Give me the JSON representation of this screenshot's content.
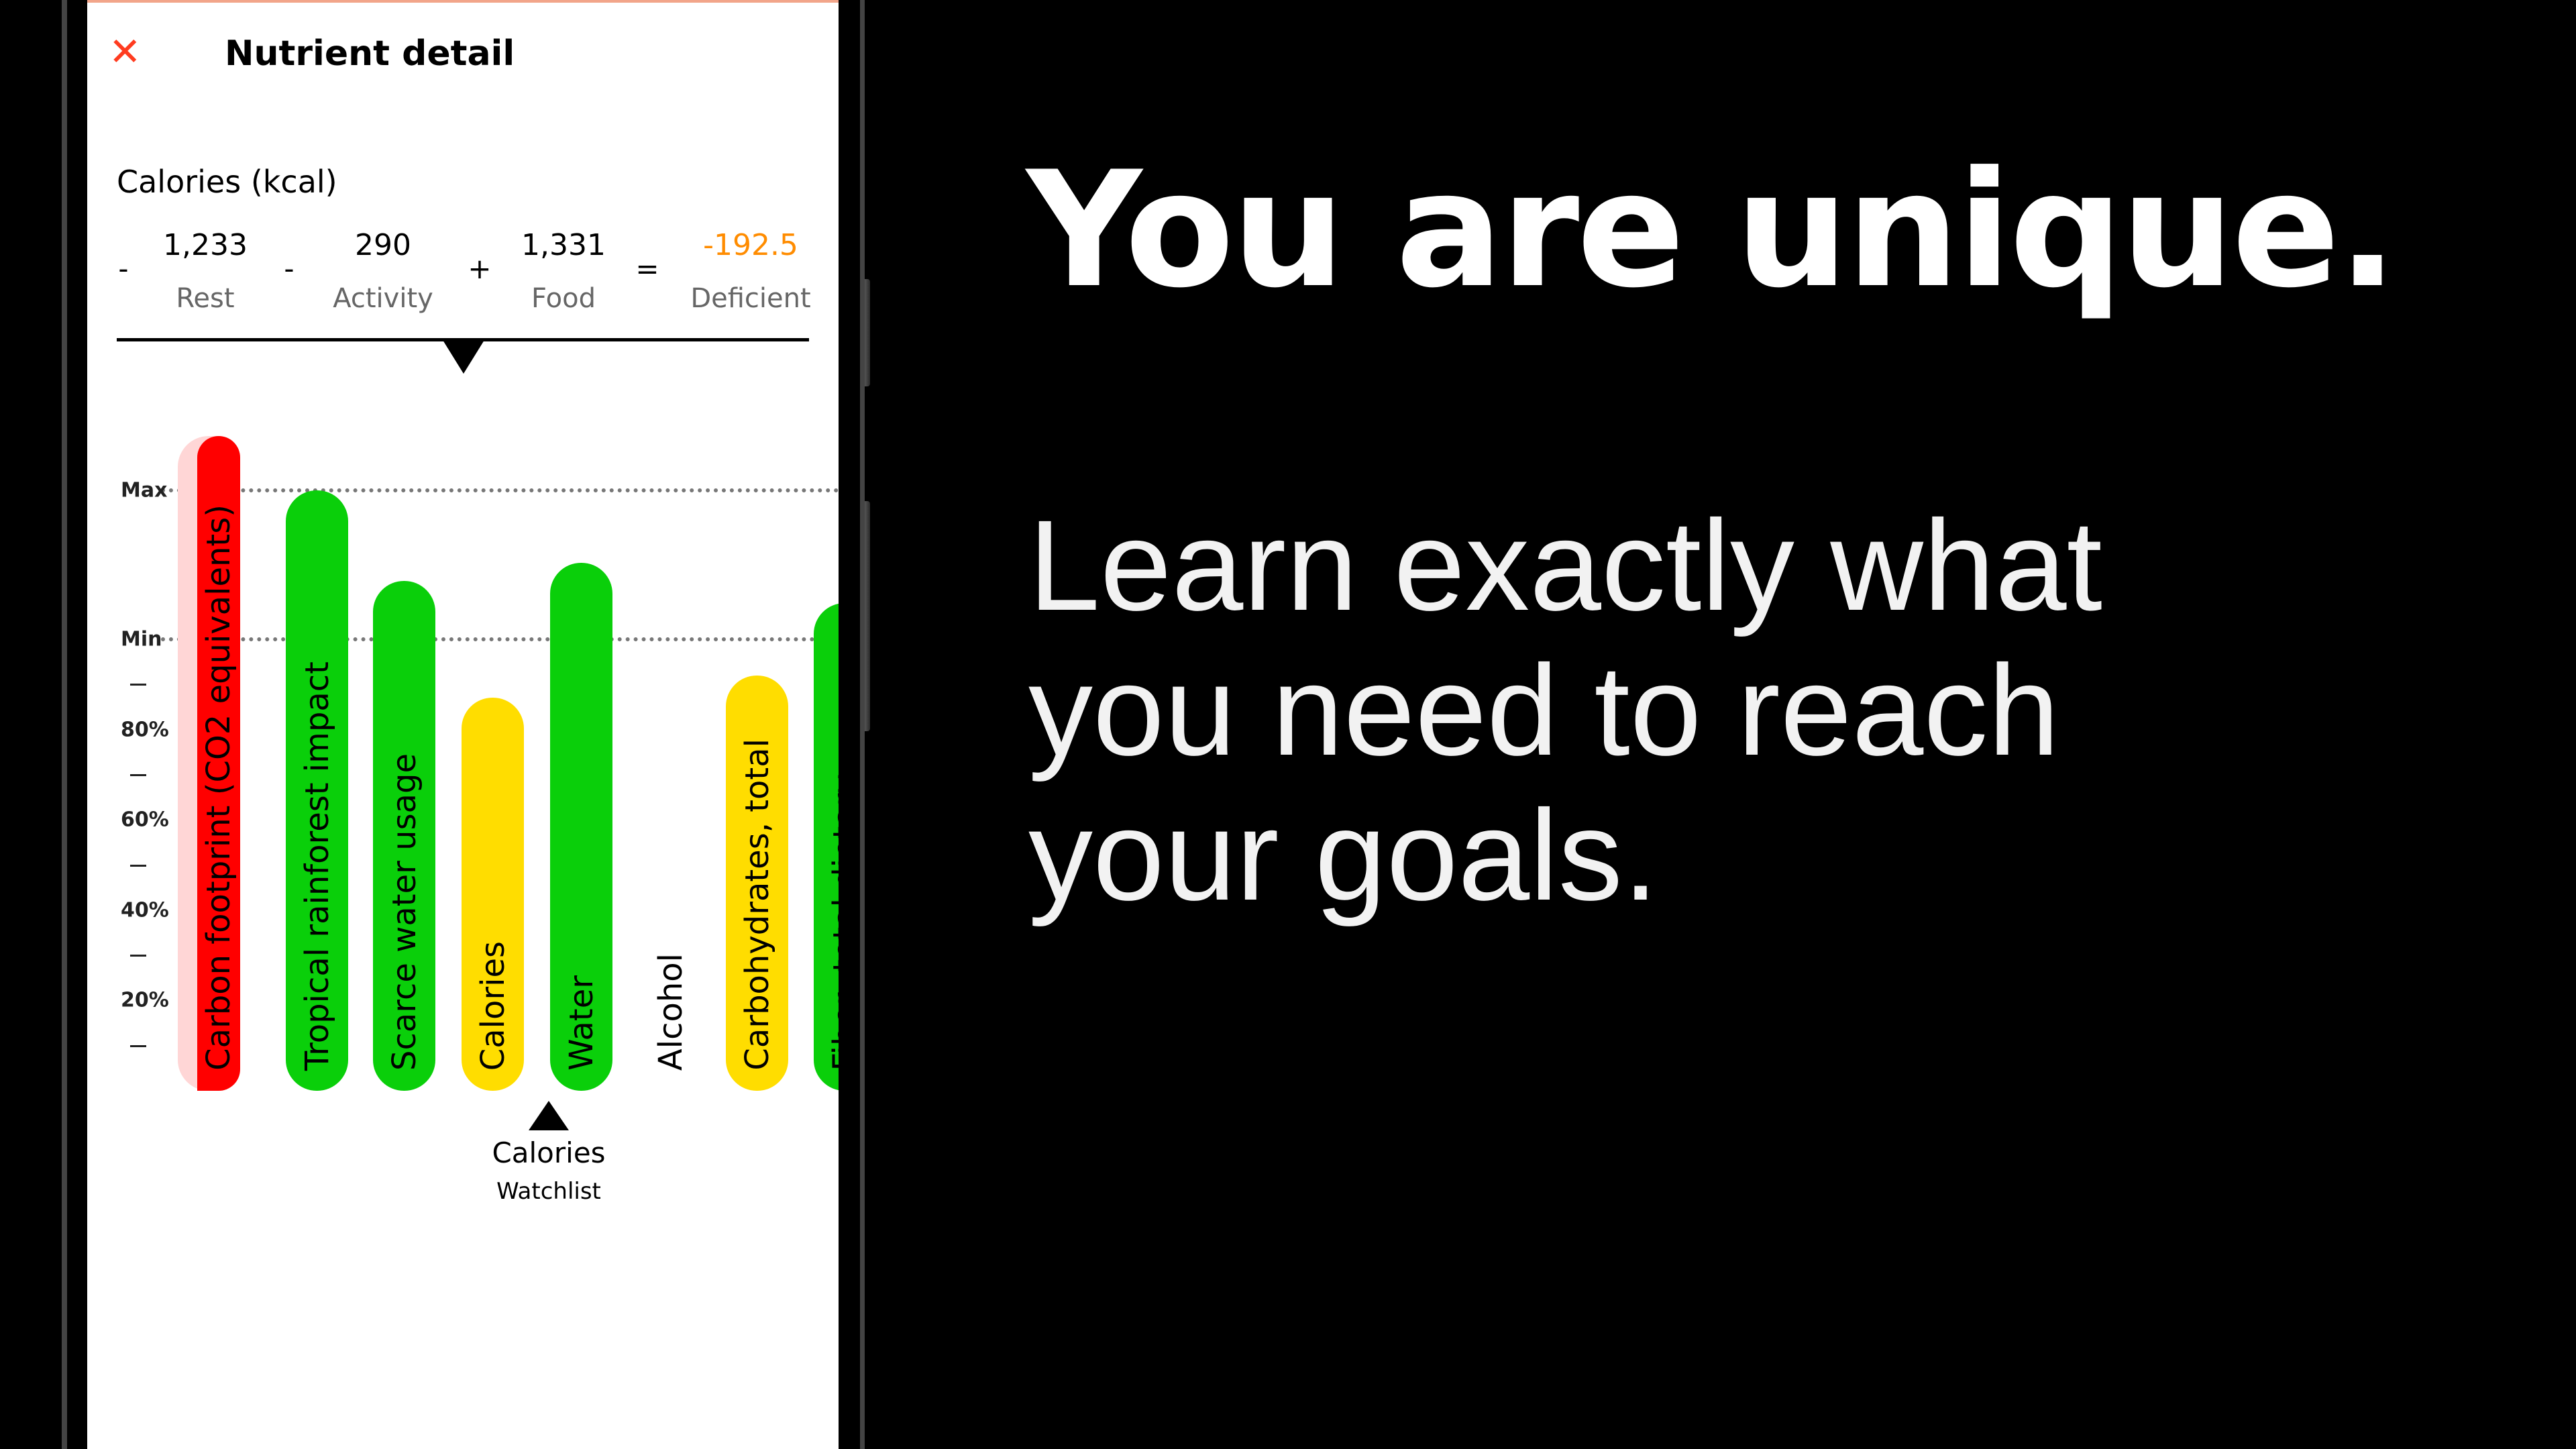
{
  "header": {
    "close_icon": "close-x-icon",
    "title": "Nutrient detail"
  },
  "summary": {
    "heading": "Calories (kcal)",
    "items": [
      {
        "op": "-",
        "value": "1,233",
        "label": "Rest"
      },
      {
        "op": "-",
        "value": "290",
        "label": "Activity"
      },
      {
        "op": "+",
        "value": "1,331",
        "label": "Food"
      },
      {
        "op": "=",
        "value": "-192.5",
        "label": "Deficient"
      }
    ],
    "deficient_color": "#FF8C00"
  },
  "chart_data": {
    "type": "bar",
    "axis_labels": [
      "Max",
      "Min",
      "80%",
      "60%",
      "40%",
      "20%"
    ],
    "reference_lines": {
      "Max": 133,
      "Min": 100
    },
    "ylim": [
      0,
      145
    ],
    "categories": [
      "Carbon footprint (CO2 equivalents)",
      "Tropical rainforest impact",
      "Scarce water usage",
      "Calories",
      "Water",
      "Alcohol",
      "Carbohydrates, total",
      "Fiber, total dietary"
    ],
    "values": [
      145,
      133,
      113,
      87,
      117,
      0,
      92,
      108
    ],
    "colors": [
      "#FF0000",
      "#0ACF0A",
      "#0ACF0A",
      "#FFDD00",
      "#0ACF0A",
      "#FFFFFF",
      "#FFDD00",
      "#0ACF0A"
    ]
  },
  "selected": {
    "name": "Calories",
    "list": "Watchlist"
  },
  "promo": {
    "headline": "You are unique.",
    "body_lines": [
      "Learn exactly what",
      "you need to reach",
      "your goals."
    ]
  }
}
